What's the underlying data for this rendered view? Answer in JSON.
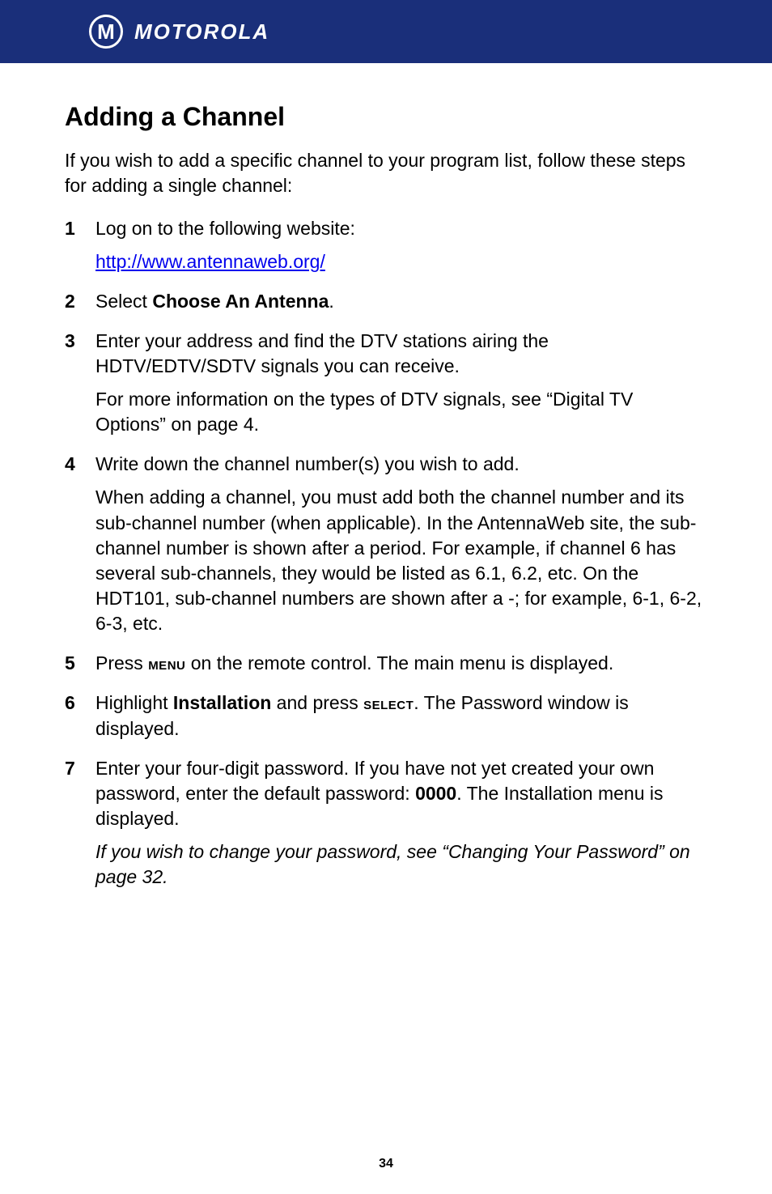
{
  "header": {
    "logo_glyph": "M",
    "brand": "MOTOROLA"
  },
  "title": "Adding a Channel",
  "intro": "If you wish to add a specific channel to your program list, follow these steps for adding a single channel:",
  "steps": {
    "s1": {
      "text": "Log on to the following website:",
      "link": "http://www.antennaweb.org/"
    },
    "s2": {
      "pre": "Select ",
      "bold": "Choose An Antenna",
      "post": "."
    },
    "s3": {
      "p1": "Enter your address and find the DTV stations airing the HDTV/EDTV/SDTV signals you can receive.",
      "p2": "For more information on the types of DTV signals, see “Digital TV Options” on page 4."
    },
    "s4": {
      "p1": "Write down the channel number(s) you wish to add.",
      "p2": "When adding a channel, you must add both the channel number and its sub-channel number (when applicable). In the AntennaWeb site, the sub-channel number is shown after a period. For example, if channel 6 has several sub-channels, they would be listed as 6.1, 6.2, etc. On the HDT101, sub-channel numbers are shown after a -; for example, 6-1, 6-2, 6-3, etc."
    },
    "s5": {
      "pre": "Press ",
      "sc": "menu",
      "post": " on the remote control. The main menu is displayed."
    },
    "s6": {
      "pre": "Highlight ",
      "bold": "Installation",
      "mid": " and press ",
      "sc": "select",
      "post": ". The Password window is displayed."
    },
    "s7": {
      "pre": "Enter your four-digit password. If you have not yet created your own password, enter the default password: ",
      "bold": "0000",
      "post": ". The Installation menu is displayed.",
      "note": "If you wish to change your password, see “Changing Your Password” on page 32."
    }
  },
  "page_number": "34"
}
